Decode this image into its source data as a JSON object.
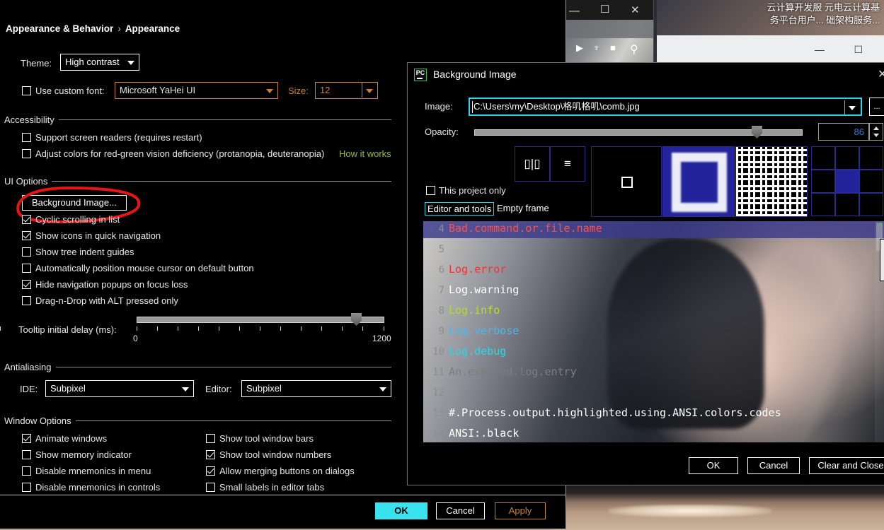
{
  "settings_dialog": {
    "breadcrumb": {
      "root": "Appearance & Behavior",
      "separator": "›",
      "leaf": "Appearance"
    },
    "theme": {
      "label": "Theme:",
      "value": "High contrast"
    },
    "custom_font": {
      "checkbox_label": "Use custom font:",
      "checked": false,
      "value": "Microsoft YaHei UI",
      "size_label": "Size:",
      "size_value": "12"
    },
    "accessibility": {
      "group_title": "Accessibility",
      "items": [
        {
          "label": "Support screen readers (requires restart)",
          "checked": false
        },
        {
          "label": "Adjust colors for red-green vision deficiency (protanopia, deuteranopia)",
          "checked": false
        }
      ],
      "how_it_works": "How it works"
    },
    "ui_options": {
      "group_title": "UI Options",
      "background_image_button": "Background Image...",
      "items": [
        {
          "label": "Cyclic scrolling in list",
          "checked": true
        },
        {
          "label": "Show icons in quick navigation",
          "checked": true
        },
        {
          "label": "Show tree indent guides",
          "checked": false
        },
        {
          "label": "Automatically position mouse cursor on default button",
          "checked": false
        },
        {
          "label": "Hide navigation popups on focus loss",
          "checked": true
        },
        {
          "label": "Drag-n-Drop with ALT pressed only",
          "checked": false
        }
      ],
      "tooltip_delay": {
        "label": "Tooltip initial delay (ms):",
        "min": "0",
        "max": "1200",
        "value_percent": 87
      }
    },
    "antialiasing": {
      "group_title": "Antialiasing",
      "ide_label": "IDE:",
      "ide_value": "Subpixel",
      "editor_label": "Editor:",
      "editor_value": "Subpixel"
    },
    "window_options": {
      "group_title": "Window Options",
      "left_items": [
        {
          "label": "Animate windows",
          "checked": true
        },
        {
          "label": "Show memory indicator",
          "checked": false
        },
        {
          "label": "Disable mnemonics in menu",
          "checked": false
        },
        {
          "label": "Disable mnemonics in controls",
          "checked": false
        }
      ],
      "right_items": [
        {
          "label": "Show tool window bars",
          "checked": false
        },
        {
          "label": "Show tool window numbers",
          "checked": true
        },
        {
          "label": "Allow merging buttons on dialogs",
          "checked": true
        },
        {
          "label": "Small labels in editor tabs",
          "checked": false
        }
      ]
    },
    "buttons": {
      "ok": "OK",
      "cancel": "Cancel",
      "apply": "Apply"
    }
  },
  "background_image_dialog": {
    "title": "Background Image",
    "app_icon_text": "PC",
    "close_glyph": "✕",
    "image": {
      "label": "Image:",
      "value": "C:\\Users\\my\\Desktop\\格叽格叽\\comb.jpg",
      "browse_label": "..."
    },
    "opacity": {
      "label": "Opacity:",
      "value": "86",
      "slider_percent": 85
    },
    "mirror_horizontal_icon": "▯|▯",
    "mirror_vertical_icon": "≡",
    "fill_modes": [
      "center",
      "scale",
      "tile"
    ],
    "fill_selected_index": 1,
    "anchor_selected": "middle-center",
    "this_project_only": {
      "label": "This project only",
      "checked": false
    },
    "scope_toggle": {
      "selected": "Editor and tools",
      "other": "Empty frame"
    },
    "buttons": {
      "ok": "OK",
      "cancel": "Cancel",
      "clear_and_close": "Clear and Close"
    },
    "preview_code": [
      {
        "num": "4",
        "text": "Bad.command.or.file.name",
        "color": "#ff4d4d",
        "selected": true
      },
      {
        "num": "5",
        "text": "",
        "color": "#cfcfcf",
        "selected": false
      },
      {
        "num": "6",
        "text": "Log.error",
        "color": "#ff2d2d",
        "selected": false
      },
      {
        "num": "7",
        "text": "Log.warning",
        "color": "#ffffff",
        "selected": false
      },
      {
        "num": "8",
        "text": "Log.info",
        "color": "#b9d92a",
        "selected": false
      },
      {
        "num": "9",
        "text": "Log.verbose",
        "color": "#4ab8f0",
        "selected": false
      },
      {
        "num": "10",
        "text": "Log.debug",
        "color": "#2ad7e8",
        "selected": false
      },
      {
        "num": "11",
        "text": "An.expired.log.entry",
        "color": "#7d7d7d",
        "selected": false
      },
      {
        "num": "12",
        "text": "",
        "color": "#cfcfcf",
        "selected": false
      },
      {
        "num": "13",
        "text": "#.Process.output.highlighted.using.ANSI.colors.codes",
        "color": "#ffffff",
        "selected": false
      },
      {
        "num": "14",
        "text": "ANSI:.black",
        "color": "#ffffff",
        "selected": false
      }
    ]
  },
  "background_windows": {
    "browser_text_line1": "云计算开发服 元电云计算基",
    "browser_text_line2": "务平台用户... 础架构服务...",
    "minimize_glyph": "—",
    "maximize_glyph": "☐",
    "close_glyph": "✕",
    "play_glyph": "▶",
    "stop_glyph": "■",
    "search_glyph": "⚲",
    "more_glyph": "⋯"
  }
}
